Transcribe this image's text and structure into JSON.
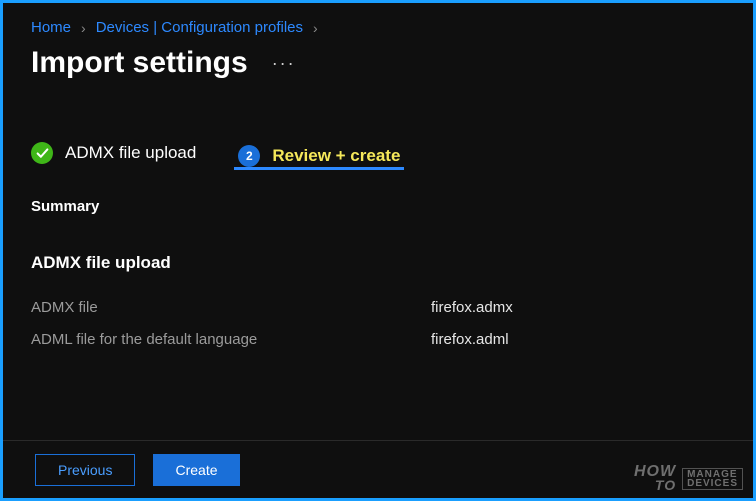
{
  "breadcrumb": {
    "home": "Home",
    "devices": "Devices | Configuration profiles"
  },
  "title": "Import settings",
  "steps": {
    "step1": {
      "label": "ADMX file upload"
    },
    "step2": {
      "num": "2",
      "label": "Review + create"
    }
  },
  "summary_heading": "Summary",
  "section_heading": "ADMX file upload",
  "rows": [
    {
      "label": "ADMX file",
      "value": "firefox.admx"
    },
    {
      "label": "ADML file for the default language",
      "value": "firefox.adml"
    }
  ],
  "buttons": {
    "previous": "Previous",
    "create": "Create"
  },
  "watermark": {
    "how": "HOW",
    "to": "TO",
    "manage": "MANAGE",
    "devices": "DEVICES"
  }
}
